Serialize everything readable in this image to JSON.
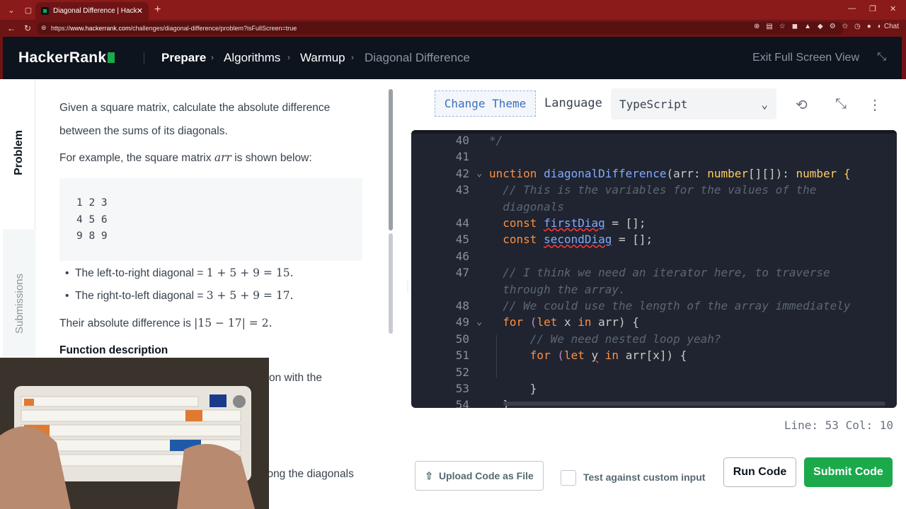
{
  "browser": {
    "tab_title": "Diagonal Difference | HackerRank",
    "url_prefix": "https://",
    "url_domain": "www.hackerrank.com",
    "url_path": "/challenges/diagonal-difference/problem?isFullScreen=true",
    "chat_label": "Chat"
  },
  "header": {
    "logo": "HackerRank",
    "breadcrumbs": [
      "Prepare",
      "Algorithms",
      "Warmup",
      "Diagonal Difference"
    ],
    "exit_fullscreen": "Exit Full Screen View"
  },
  "side_tabs": {
    "problem": "Problem",
    "submissions": "Submissions"
  },
  "problem": {
    "intro": "Given a square matrix, calculate the absolute difference between the sums of its diagonals.",
    "example_prefix": "For example, the square matrix",
    "example_var": "arr",
    "example_suffix": "is shown below:",
    "matrix_rows": [
      "1 2 3",
      "4 5 6",
      "9 8 9"
    ],
    "bullet1_prefix": "The left-to-right diagonal =",
    "bullet1_math": "1 + 5 + 9 = 15.",
    "bullet2_prefix": "The right-to-left diagonal =",
    "bullet2_math": "3 + 5 + 9 = 17.",
    "abs_prefix": "Their absolute difference is",
    "abs_math": "|15 − 17| = 2.",
    "func_heading": "Function description",
    "partial_line1": "on with the",
    "partial_line2": "long the diagonals"
  },
  "editor_toolbar": {
    "change_theme": "Change Theme",
    "language_label": "Language",
    "language_value": "TypeScript"
  },
  "code_lines": [
    {
      "n": "40",
      "fold": ""
    },
    {
      "n": "41",
      "fold": ""
    },
    {
      "n": "42",
      "fold": "⌄"
    },
    {
      "n": "43",
      "fold": ""
    },
    {
      "n": "",
      "fold": ""
    },
    {
      "n": "44",
      "fold": ""
    },
    {
      "n": "45",
      "fold": ""
    },
    {
      "n": "46",
      "fold": ""
    },
    {
      "n": "47",
      "fold": ""
    },
    {
      "n": "",
      "fold": ""
    },
    {
      "n": "48",
      "fold": ""
    },
    {
      "n": "49",
      "fold": "⌄"
    },
    {
      "n": "50",
      "fold": ""
    },
    {
      "n": "51",
      "fold": ""
    },
    {
      "n": "52",
      "fold": ""
    },
    {
      "n": "53",
      "fold": ""
    },
    {
      "n": "54",
      "fold": ""
    }
  ],
  "code_text": {
    "l40": "*/",
    "l42_a": "unction ",
    "l42_fn": "diagonalDifference",
    "l42_b": "(arr: ",
    "l42_t1": "number",
    "l42_c": "[][]): ",
    "l42_t2": "number",
    "l42_d": " {",
    "l43": "  // This is the variables for the values of the",
    "l43b": "  diagonals",
    "l44_kw": "  const ",
    "l44_v": "firstDiag",
    "l44_r": " = [];",
    "l45_kw": "  const ",
    "l45_v": "secondDiag",
    "l45_r": " = [];",
    "l47": "  // I think we need an iterator here, to traverse",
    "l47b": "  through the array.",
    "l48": "  // We could use the length of the array immediately",
    "l49_kw": "  for ",
    "l49_a": "(",
    "l49_let": "let",
    "l49_b": " x ",
    "l49_in": "in",
    "l49_c": " arr) {",
    "l50": "      // We need nested loop yeah?",
    "l51_kw": "      for ",
    "l51_a": "(",
    "l51_let": "let",
    "l51_b": " ",
    "l51_y": "y",
    "l51_c": " ",
    "l51_in": "in",
    "l51_d": " arr[x]) {",
    "l53": "      }",
    "l54": "  }"
  },
  "status": {
    "line": "Line: 53",
    "col": "Col: 10"
  },
  "actions": {
    "upload": "Upload Code as File",
    "custom_input": "Test against custom input",
    "run": "Run Code",
    "submit": "Submit Code"
  },
  "colors": {
    "brand_green": "#1ba94c",
    "header_bg": "#0e141e",
    "browser_frame": "#8b1a1a",
    "editor_bg": "#1f2430"
  }
}
